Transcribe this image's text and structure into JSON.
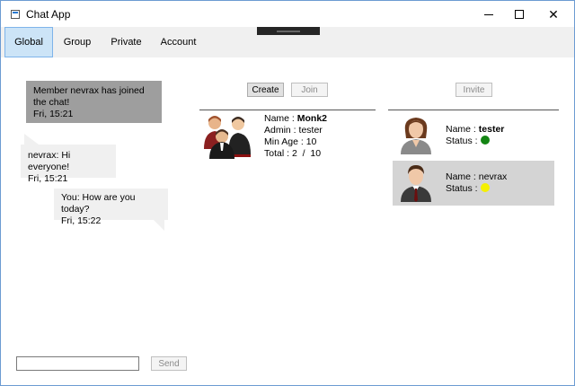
{
  "window": {
    "title": "Chat App"
  },
  "tabs": [
    {
      "label": "Global",
      "active": true
    },
    {
      "label": "Group"
    },
    {
      "label": "Private"
    },
    {
      "label": "Account"
    }
  ],
  "messages": [
    {
      "text": "Member nevrax has joined the chat!",
      "time": "Fri, 15:21"
    },
    {
      "text": "nevrax: Hi everyone!",
      "time": "Fri, 15:21"
    },
    {
      "text": "You: How are you today?",
      "time": "Fri, 15:22"
    }
  ],
  "group_panel": {
    "create_label": "Create",
    "join_label": "Join",
    "name_label": "Name :",
    "name_value": "Monk2",
    "admin_label": "Admin :",
    "admin_value": "tester",
    "min_age_label": "Min Age :",
    "min_age_value": "10",
    "total_label": "Total :",
    "total_value": "2  /  10"
  },
  "users_panel": {
    "invite_label": "Invite",
    "users": [
      {
        "name_label": "Name :",
        "name": "tester",
        "status_label": "Status :",
        "status_color": "#138513"
      },
      {
        "name_label": "Name :",
        "name": "nevrax",
        "status_label": "Status :",
        "status_color": "#f5f000"
      }
    ]
  },
  "composer": {
    "input_value": "",
    "send_label": "Send"
  },
  "colors": {
    "tab_active_bg": "#cce4f7",
    "system_bubble": "#9e9e9e",
    "selected_user": "#d4d4d4"
  }
}
